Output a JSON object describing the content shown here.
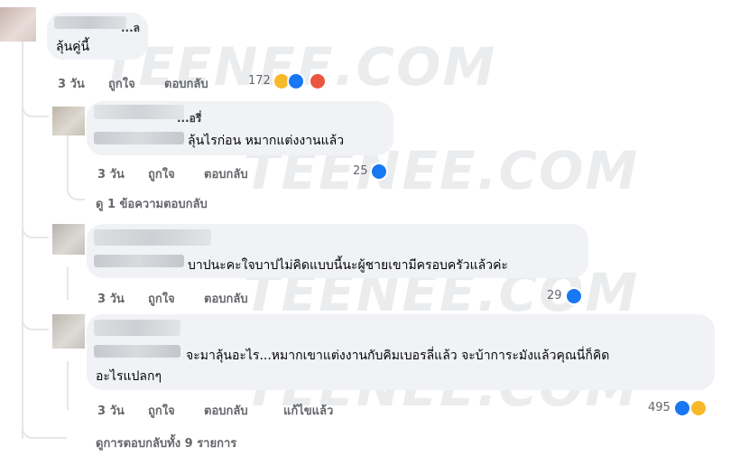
{
  "watermark": "TEENEE.COM",
  "comment1": {
    "author": "...ล",
    "text": "ลุ้นคู่นี้",
    "time": "3 วัน",
    "like": "ถูกใจ",
    "reply": "ตอบกลับ",
    "reaction_count": "172",
    "reactions": [
      "haha-icon",
      "like-icon",
      "angry-icon"
    ]
  },
  "reply1": {
    "author": "...อรี่",
    "text": "ลุ้นไรก่อน หมากแต่งงานแล้ว",
    "time": "3 วัน",
    "like": "ถูกใจ",
    "reply": "ตอบกลับ",
    "reaction_count": "25",
    "reactions": [
      "like-icon"
    ]
  },
  "view_replies_1": "ดู 1 ข้อความตอบกลับ",
  "reply2": {
    "text": "บาปนะคะใจบาปไม่คิดแบบนี้นะผู้ชายเขามีครอบครัวแล้วค่ะ",
    "time": "3 วัน",
    "like": "ถูกใจ",
    "reply": "ตอบกลับ",
    "reaction_count": "29",
    "reactions": [
      "like-icon"
    ]
  },
  "reply3": {
    "text_line1": "จะมาลุ้นอะไร...หมากเขาแต่งงานกับคิมเบอรลี่แล้ว จะบ้าการะมังแล้วคุณนี่ก็คิด",
    "text_line2": "อะไรแปลกๆ",
    "time": "3 วัน",
    "like": "ถูกใจ",
    "reply": "ตอบกลับ",
    "edited": "แก้ไขแล้ว",
    "reaction_count": "495",
    "reactions": [
      "like-icon",
      "haha-icon"
    ]
  },
  "view_all_replies": "ดูการตอบกลับทั้ง 9 รายการ",
  "colors": {
    "bubble": "#f0f2f5",
    "meta_text": "#65676b",
    "like_blue": "#1877f2",
    "haha_yellow": "#f7b928",
    "angry_red": "#e9573f"
  }
}
